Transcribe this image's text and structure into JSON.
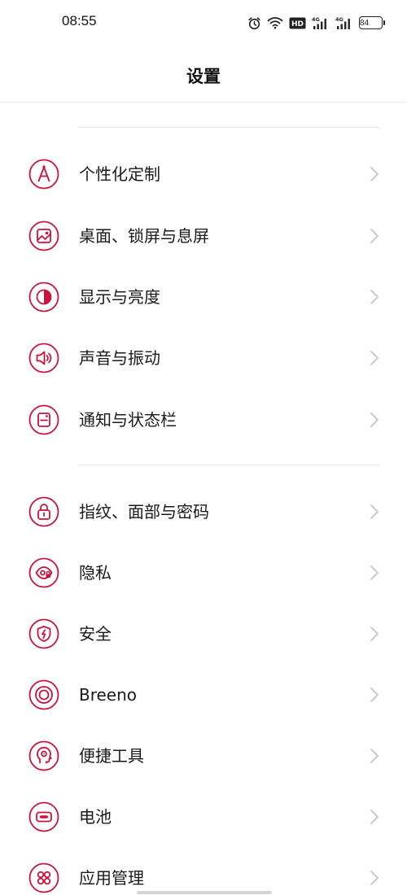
{
  "status_bar": {
    "time": "08:55",
    "battery": "84",
    "network_1": "4G",
    "network_2": "4G",
    "hd_badge": "HD"
  },
  "header": {
    "title": "设置"
  },
  "accent_color": "#c8143c",
  "groups": [
    {
      "items": [
        {
          "label": "个性化定制",
          "icon": "personalization-icon"
        },
        {
          "label": "桌面、锁屏与息屏",
          "icon": "wallpaper-icon"
        },
        {
          "label": "显示与亮度",
          "icon": "display-brightness-icon"
        },
        {
          "label": "声音与振动",
          "icon": "sound-icon"
        },
        {
          "label": "通知与状态栏",
          "icon": "notification-icon"
        }
      ]
    },
    {
      "items": [
        {
          "label": "指纹、面部与密码",
          "icon": "lock-icon"
        },
        {
          "label": "隐私",
          "icon": "privacy-eye-icon"
        },
        {
          "label": "安全",
          "icon": "security-shield-icon"
        },
        {
          "label": "Breeno",
          "icon": "breeno-icon"
        },
        {
          "label": "便捷工具",
          "icon": "convenience-tools-icon"
        },
        {
          "label": "电池",
          "icon": "battery-icon"
        },
        {
          "label": "应用管理",
          "icon": "app-management-icon"
        }
      ]
    }
  ]
}
